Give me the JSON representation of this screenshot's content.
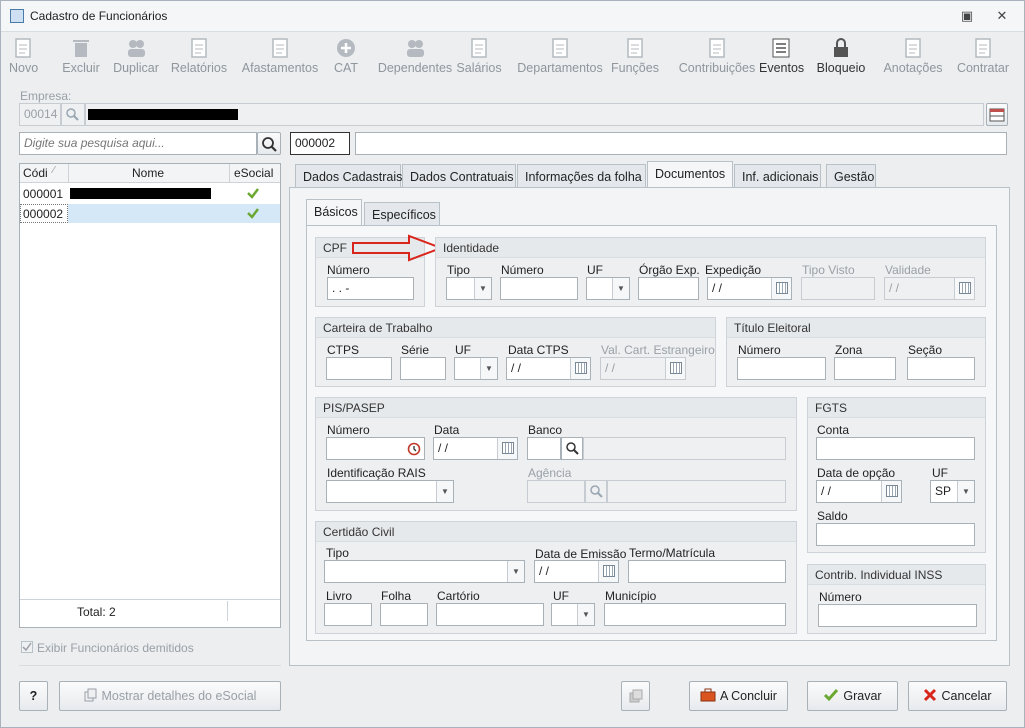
{
  "window": {
    "title": "Cadastro de Funcionários"
  },
  "toolbar": [
    {
      "label": "Novo",
      "icon": "new-doc-icon",
      "enabled": false
    },
    {
      "label": "Excluir",
      "icon": "trash-icon",
      "enabled": false
    },
    {
      "label": "Duplicar",
      "icon": "duplicate-users-icon",
      "enabled": false
    },
    {
      "label": "Relatórios",
      "icon": "report-icon",
      "enabled": false
    },
    {
      "label": "Afastamentos",
      "icon": "house-arrow-icon",
      "enabled": false
    },
    {
      "label": "CAT",
      "icon": "plus-circle-icon",
      "enabled": false
    },
    {
      "label": "Dependentes",
      "icon": "users-icon",
      "enabled": false
    },
    {
      "label": "Salários",
      "icon": "money-icon",
      "enabled": false
    },
    {
      "label": "Departamentos",
      "icon": "desk-icon",
      "enabled": false
    },
    {
      "label": "Funções",
      "icon": "clipboard-icon",
      "enabled": false
    },
    {
      "label": "Contribuições",
      "icon": "contributions-icon",
      "enabled": false
    },
    {
      "label": "Eventos",
      "icon": "list-icon",
      "enabled": true
    },
    {
      "label": "Bloqueio",
      "icon": "lock-icon",
      "enabled": true
    },
    {
      "label": "Anotações",
      "icon": "notes-icon",
      "enabled": false
    },
    {
      "label": "Contratar",
      "icon": "contract-icon",
      "enabled": false
    }
  ],
  "empresa": {
    "label": "Empresa:",
    "code": "00014",
    "name": ""
  },
  "search": {
    "placeholder": "Digite sua pesquisa aqui...",
    "code_value": "000002",
    "name_value": ""
  },
  "employee_list": {
    "columns": [
      "Códi",
      "Nome",
      "eSocial"
    ],
    "rows": [
      {
        "code": "000001",
        "name": "",
        "esocial": "check"
      },
      {
        "code": "000002",
        "name": "",
        "esocial": "check"
      }
    ],
    "total": "Total: 2"
  },
  "show_dismissed": {
    "label": "Exibir Funcionários demitidos"
  },
  "tabs": [
    "Dados Cadastrais",
    "Dados Contratuais",
    "Informações da folha",
    "Documentos",
    "Inf. adicionais",
    "Gestão"
  ],
  "subtabs": [
    "Básicos",
    "Específicos"
  ],
  "cpf": {
    "title": "CPF",
    "numero_label": "Número",
    "numero_value": " .  .  -"
  },
  "identidade": {
    "title": "Identidade",
    "labels": {
      "tipo": "Tipo",
      "numero": "Número",
      "uf": "UF",
      "orgao": "Órgão Exp.",
      "expedicao": "Expedição",
      "tipo_visto": "Tipo Visto",
      "validade": "Validade"
    },
    "expedicao_value": " / /",
    "validade_value": " / /"
  },
  "ctps": {
    "title": "Carteira de Trabalho",
    "labels": {
      "ctps": "CTPS",
      "serie": "Série",
      "uf": "UF",
      "data": "Data CTPS",
      "val": "Val. Cart. Estrangeiro"
    },
    "data_value": " / /",
    "val_value": " / /"
  },
  "titulo": {
    "title": "Título Eleitoral",
    "labels": {
      "numero": "Número",
      "zona": "Zona",
      "secao": "Seção"
    }
  },
  "pis": {
    "title": "PIS/PASEP",
    "labels": {
      "numero": "Número",
      "data": "Data",
      "banco": "Banco",
      "rais": "Identificação RAIS",
      "agencia": "Agência"
    },
    "data_value": " / /"
  },
  "fgts": {
    "title": "FGTS",
    "labels": {
      "conta": "Conta",
      "data_opcao": "Data de opção",
      "uf": "UF",
      "saldo": "Saldo"
    },
    "data_value": " / /",
    "uf_value": "SP"
  },
  "certidao": {
    "title": "Certidão Civil",
    "labels": {
      "tipo": "Tipo",
      "data_emissao": "Data de Emissão",
      "termo": "Termo/Matrícula",
      "livro": "Livro",
      "folha": "Folha",
      "cartorio": "Cartório",
      "uf": "UF",
      "municipio": "Município"
    },
    "data_value": " / /"
  },
  "inss": {
    "title": "Contrib. Individual INSS",
    "numero_label": "Número"
  },
  "buttons": {
    "help": "?",
    "esocial_details": "Mostrar detalhes do eSocial",
    "concluir": "A Concluir",
    "gravar": "Gravar",
    "cancelar": "Cancelar"
  },
  "colors": {
    "accent_red": "#d9261c",
    "check_green": "#6aa832",
    "selection": "#d5e8f7"
  }
}
